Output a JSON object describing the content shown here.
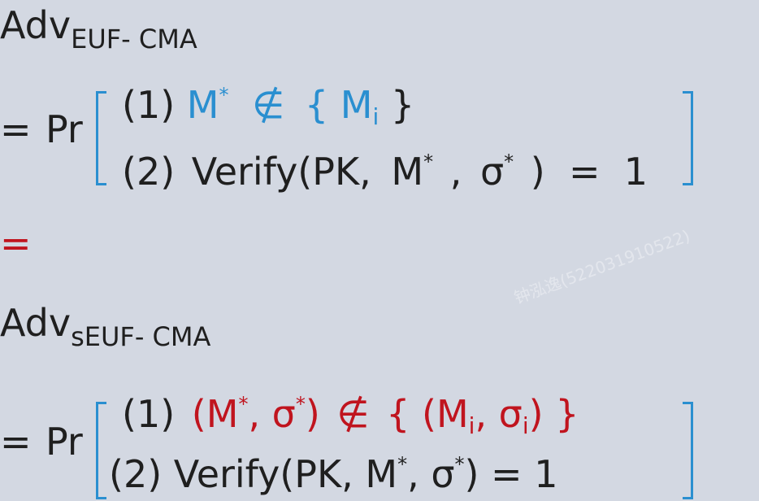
{
  "adv1": {
    "base": "Adv",
    "sub": "EUF- CMA"
  },
  "eq1": {
    "eq": "=",
    "pr": "Pr",
    "line1": {
      "num": "(1)",
      "m": "M",
      "star": "*",
      "notin": "∉",
      "lb": "{",
      "mi": "M",
      "i": "i",
      "rb": "}"
    },
    "line2": {
      "num": "(2)",
      "text": "Verify(PK,",
      "m": "M",
      "star": "*",
      "comma": ",",
      "sigma": "σ",
      "star2": "*",
      "rest": ")  =  1"
    }
  },
  "mid_eq": "=",
  "adv2": {
    "base": "Adv",
    "sub": "sEUF- CMA"
  },
  "eq2": {
    "eq": "=",
    "pr": "Pr",
    "line1": {
      "num": "(1)",
      "open": "(M",
      "star": "*",
      "comma": ", σ",
      "star2": "*",
      "close": ")",
      "notin": "∉",
      "set_open": "{ (M",
      "i": "i",
      "mid": ", σ",
      "i2": "i",
      "set_close": ") }"
    },
    "line2": {
      "num": "(2)",
      "text": "Verify(PK, M",
      "star": "*",
      "mid": ", σ",
      "star2": "*",
      "rest": ") = 1"
    }
  },
  "watermark": "钟泓逸(522031910522)",
  "colors": {
    "background": "#d3d8e2",
    "blue": "#2a8fd0",
    "red": "#c0141e",
    "text": "#1f1f1f"
  }
}
